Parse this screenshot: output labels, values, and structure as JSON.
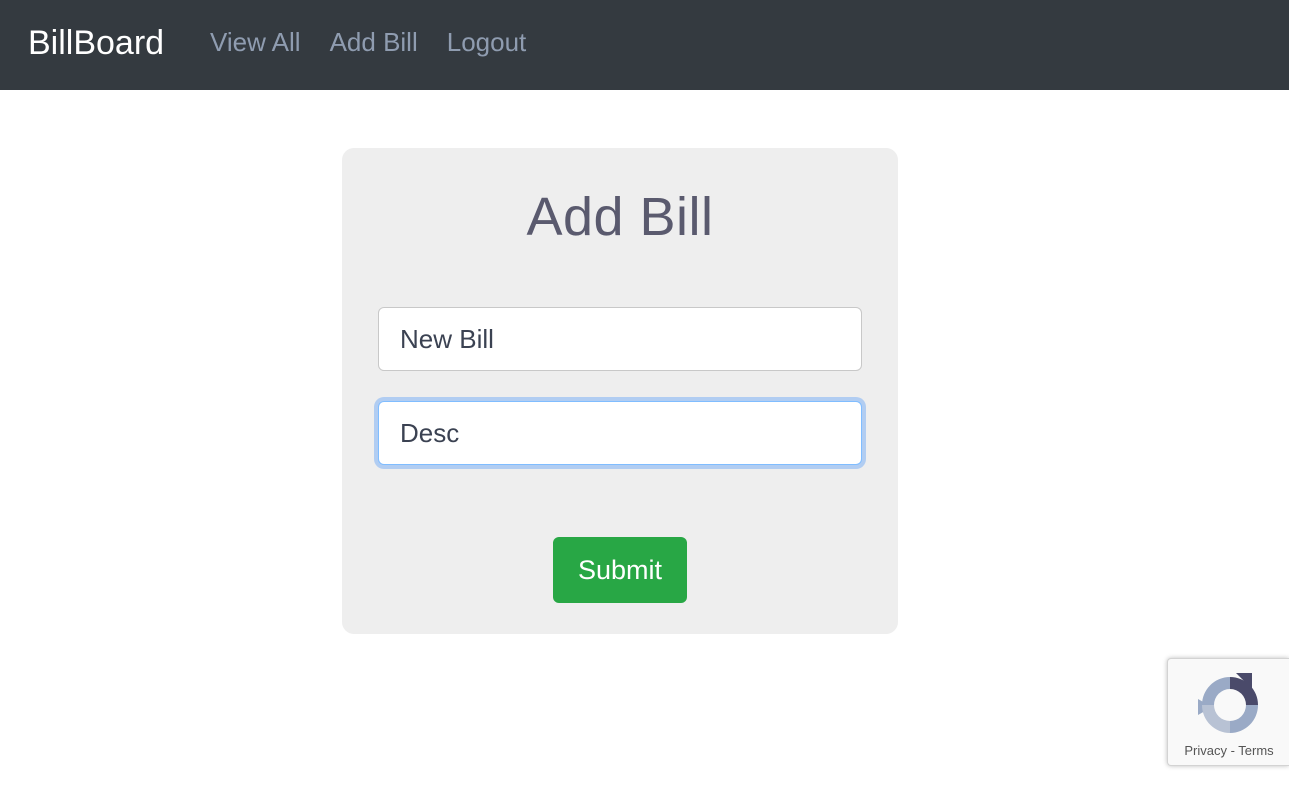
{
  "navbar": {
    "brand": "BillBoard",
    "links": [
      "View All",
      "Add Bill",
      "Logout"
    ]
  },
  "form": {
    "title": "Add Bill",
    "name_value": "New Bill",
    "description_value": "Desc",
    "submit_label": "Submit"
  },
  "recaptcha": {
    "icon": "recaptcha-logo",
    "privacy": "Privacy",
    "separator": " - ",
    "terms": "Terms"
  },
  "colors": {
    "navbar_bg": "#343a40",
    "nav_link": "#8f9cb0",
    "card_bg": "#eeeeee",
    "title": "#5a5a6e",
    "submit_bg": "#28a745",
    "focus_ring": "#80bdff"
  }
}
